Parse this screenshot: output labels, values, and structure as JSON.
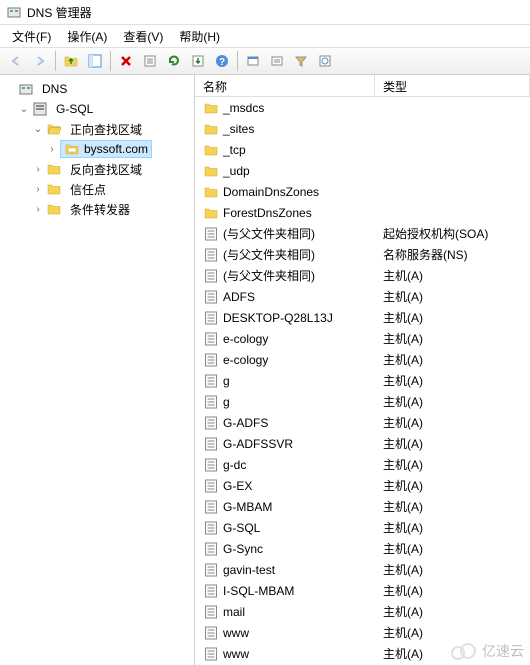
{
  "title": "DNS 管理器",
  "menu": {
    "file": "文件(F)",
    "action": "操作(A)",
    "view": "查看(V)",
    "help": "帮助(H)"
  },
  "toolbar_icons": {
    "back": "back-arrow",
    "forward": "forward-arrow",
    "up": "up-level",
    "show_hide": "show-hide",
    "delete": "delete",
    "properties": "properties",
    "refresh": "refresh",
    "export": "export",
    "help": "help",
    "new_zone": "new-zone",
    "new_record": "new-record",
    "filter": "filter",
    "find": "find"
  },
  "tree": {
    "root": "DNS",
    "server": "G-SQL",
    "fwd_zones": "正向查找区域",
    "selected_zone": "byssoft.com",
    "rev_zones": "反向查找区域",
    "trust_points": "信任点",
    "cond_fwd": "条件转发器"
  },
  "columns": {
    "name": "名称",
    "type": "类型"
  },
  "records": [
    {
      "name": "_msdcs",
      "type": "",
      "icon": "folder"
    },
    {
      "name": "_sites",
      "type": "",
      "icon": "folder"
    },
    {
      "name": "_tcp",
      "type": "",
      "icon": "folder"
    },
    {
      "name": "_udp",
      "type": "",
      "icon": "folder"
    },
    {
      "name": "DomainDnsZones",
      "type": "",
      "icon": "folder"
    },
    {
      "name": "ForestDnsZones",
      "type": "",
      "icon": "folder"
    },
    {
      "name": "(与父文件夹相同)",
      "type": "起始授权机构(SOA)",
      "icon": "rec"
    },
    {
      "name": "(与父文件夹相同)",
      "type": "名称服务器(NS)",
      "icon": "rec"
    },
    {
      "name": "(与父文件夹相同)",
      "type": "主机(A)",
      "icon": "rec"
    },
    {
      "name": "ADFS",
      "type": "主机(A)",
      "icon": "rec"
    },
    {
      "name": "DESKTOP-Q28L13J",
      "type": "主机(A)",
      "icon": "rec"
    },
    {
      "name": "e-cology",
      "type": "主机(A)",
      "icon": "rec"
    },
    {
      "name": "e-cology",
      "type": "主机(A)",
      "icon": "rec"
    },
    {
      "name": "g",
      "type": "主机(A)",
      "icon": "rec"
    },
    {
      "name": "g",
      "type": "主机(A)",
      "icon": "rec"
    },
    {
      "name": "G-ADFS",
      "type": "主机(A)",
      "icon": "rec"
    },
    {
      "name": "G-ADFSSVR",
      "type": "主机(A)",
      "icon": "rec"
    },
    {
      "name": "g-dc",
      "type": "主机(A)",
      "icon": "rec"
    },
    {
      "name": "G-EX",
      "type": "主机(A)",
      "icon": "rec"
    },
    {
      "name": "G-MBAM",
      "type": "主机(A)",
      "icon": "rec"
    },
    {
      "name": "G-SQL",
      "type": "主机(A)",
      "icon": "rec"
    },
    {
      "name": "G-Sync",
      "type": "主机(A)",
      "icon": "rec"
    },
    {
      "name": "gavin-test",
      "type": "主机(A)",
      "icon": "rec"
    },
    {
      "name": "I-SQL-MBAM",
      "type": "主机(A)",
      "icon": "rec"
    },
    {
      "name": "mail",
      "type": "主机(A)",
      "icon": "rec"
    },
    {
      "name": "www",
      "type": "主机(A)",
      "icon": "rec"
    },
    {
      "name": "www",
      "type": "主机(A)",
      "icon": "rec"
    }
  ],
  "watermark": "亿速云"
}
